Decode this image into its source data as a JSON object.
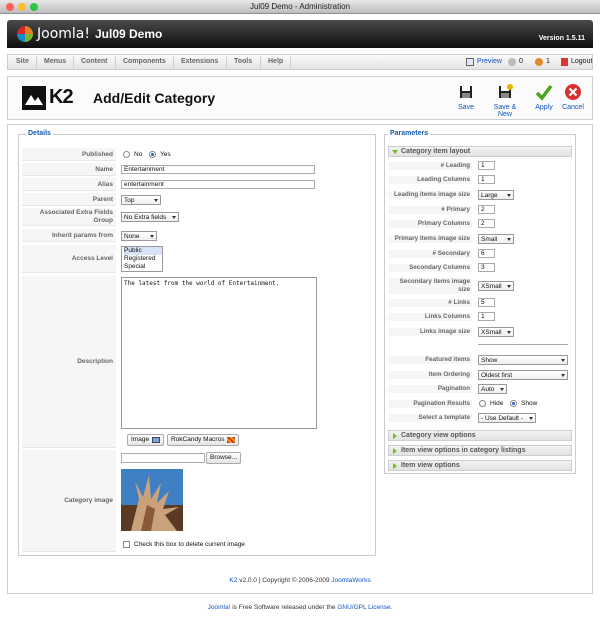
{
  "window": {
    "title": "Jul09 Demo - Administration"
  },
  "header": {
    "logo_text": "Joomla!",
    "site_name": "Jul09 Demo",
    "version": "Version 1.5.11"
  },
  "menu": {
    "items": [
      "Site",
      "Menus",
      "Content",
      "Components",
      "Extensions",
      "Tools",
      "Help"
    ]
  },
  "status": {
    "preview": "Preview",
    "messages_count": "0",
    "users_count": "1",
    "logout": "Logout"
  },
  "toolbar": {
    "logo_text": "K2",
    "page_title": "Add/Edit Category",
    "save": "Save",
    "save_new": "Save & New",
    "apply": "Apply",
    "cancel": "Cancel"
  },
  "details": {
    "legend": "Details",
    "published_label": "Published",
    "published_no": "No",
    "published_yes": "Yes",
    "name_label": "Name",
    "name_value": "Entertainment",
    "alias_label": "Alias",
    "alias_value": "entertainment",
    "parent_label": "Parent",
    "parent_value": "Top",
    "extra_fields_label": "Associated Extra Fields Group",
    "extra_fields_value": "No Extra fields",
    "inherit_label": "Inherit params from",
    "inherit_value": "None",
    "access_label": "Access Level",
    "access_options": [
      "Public",
      "Registered",
      "Special"
    ],
    "description_label": "Description",
    "description_value": "The latest from the world of Entertainment.",
    "image_button": "Image",
    "rokcandy_button": "RokCandy Macros",
    "category_image_label": "Category image",
    "browse_button": "Browse...",
    "delete_image_label": "Check this box to delete current image"
  },
  "params": {
    "legend": "Parameters",
    "item_layout_title": "Category item layout",
    "leading_label": "# Leading",
    "leading_value": "1",
    "leading_columns_label": "Leading Columns",
    "leading_columns_value": "1",
    "leading_image_label": "Leading items image size",
    "leading_image_value": "Large",
    "primary_label": "# Primary",
    "primary_value": "2",
    "primary_columns_label": "Primary Columns",
    "primary_columns_value": "2",
    "primary_image_label": "Primary items image size",
    "primary_image_value": "Small",
    "secondary_label": "# Secondary",
    "secondary_value": "6",
    "secondary_columns_label": "Secondary Columns",
    "secondary_columns_value": "3",
    "secondary_image_label": "Secondary items image size",
    "secondary_image_value": "XSmall",
    "links_label": "# Links",
    "links_value": "5",
    "links_columns_label": "Links Columns",
    "links_columns_value": "1",
    "links_image_label": "Links image size",
    "links_image_value": "XSmall",
    "featured_label": "Featured items",
    "featured_value": "Show",
    "ordering_label": "Item Ordering",
    "ordering_value": "Oldest first",
    "pagination_label": "Pagination",
    "pagination_value": "Auto",
    "pagination_results_label": "Pagination Results",
    "pagination_results_hide": "Hide",
    "pagination_results_show": "Show",
    "template_label": "Select a template",
    "template_value": "- Use Default -",
    "category_view_title": "Category view options",
    "item_view_listing_title": "Item view options in category listings",
    "item_view_title": "Item view options"
  },
  "footer": {
    "k2_link": "K2",
    "k2_version": "v2.0.0 | Copyright © 2006-2009",
    "joomlaworks_link": "JoomlaWorks",
    "joomla_link": "Joomla!",
    "joomla_text": "is Free Software released under the",
    "license_link": "GNU/GPL License."
  },
  "colors": {
    "link": "#0b55c4",
    "accent_green": "#7ab82b",
    "header_dark": "#111111",
    "legend_blue": "#135cae"
  }
}
